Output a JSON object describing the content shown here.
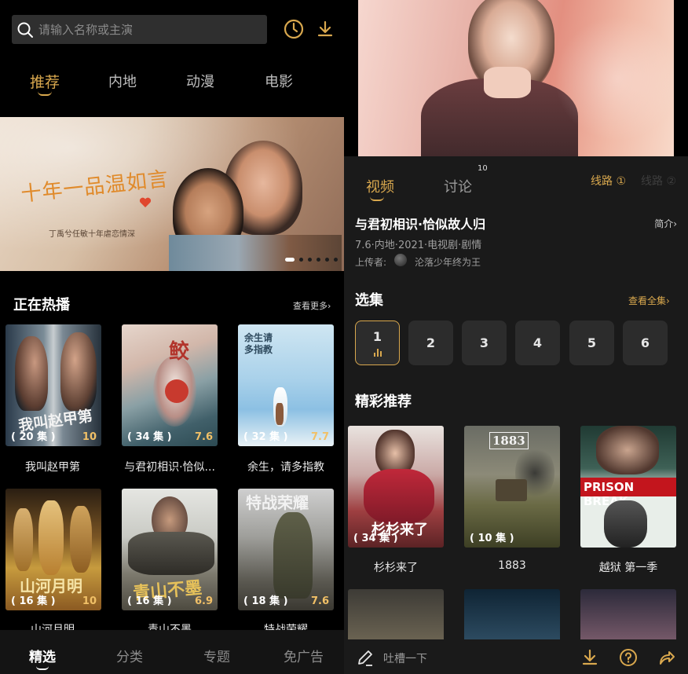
{
  "left": {
    "search": {
      "placeholder": "请输入名称或主演"
    },
    "top_icons": [
      "history-clock-icon",
      "download-icon"
    ],
    "tabs": [
      {
        "label": "推荐",
        "active": true
      },
      {
        "label": "内地",
        "active": false
      },
      {
        "label": "动漫",
        "active": false
      },
      {
        "label": "电影",
        "active": false
      }
    ],
    "banner": {
      "title": "十年一品温如言",
      "subtitle": "丁禹兮任敏十年虐恋情深",
      "slide_count": 6,
      "active_slide": 1
    },
    "hot": {
      "title": "正在热播",
      "more": "查看更多›",
      "items": [
        {
          "title": "我叫赵甲第",
          "episodes": "( 20 集 )",
          "score": "10",
          "poster_text": "我叫赵甲第"
        },
        {
          "title": "与君初相识·恰似...",
          "episodes": "( 34 集 )",
          "score": "7.6",
          "poster_text": "鲛"
        },
        {
          "title": "余生，请多指教",
          "episodes": "( 32 集 )",
          "score": "7.7",
          "poster_text": "余生请多指教"
        },
        {
          "title": "山河月明",
          "episodes": "( 16 集 )",
          "score": "10",
          "poster_text": "山河月明"
        },
        {
          "title": "青山不墨",
          "episodes": "( 16 集 )",
          "score": "6.9",
          "poster_text": "青山不墨"
        },
        {
          "title": "特战荣耀",
          "episodes": "( 18 集 )",
          "score": "7.6",
          "poster_text": "特战荣耀"
        }
      ]
    },
    "bottom_nav": [
      {
        "label": "精选",
        "active": true
      },
      {
        "label": "分类",
        "active": false
      },
      {
        "label": "专题",
        "active": false
      },
      {
        "label": "免广告",
        "active": false
      }
    ]
  },
  "right": {
    "tabs": [
      {
        "label": "视频",
        "active": true
      },
      {
        "label": "讨论",
        "active": false
      }
    ],
    "discuss_count": "10",
    "routes": [
      {
        "label": "线路 ①",
        "active": true
      },
      {
        "label": "线路 ②",
        "active": false
      }
    ],
    "show": {
      "title": "与君初相识·恰似故人归",
      "intro": "简介›",
      "meta": "7.6·内地·2021·电视剧·剧情",
      "uploader_label": "上传者:",
      "uploader_name": "沦落少年终为王"
    },
    "episodes": {
      "title": "选集",
      "view_all": "查看全集›",
      "list": [
        "1",
        "2",
        "3",
        "4",
        "5",
        "6"
      ],
      "current": "1"
    },
    "recommend": {
      "title": "精彩推荐",
      "items": [
        {
          "title": "杉杉来了",
          "episodes": "( 34 集 )",
          "poster_text": "杉杉来了"
        },
        {
          "title": "1883",
          "episodes": "( 10 集 )",
          "poster_text": "1883"
        },
        {
          "title": "越狱 第一季",
          "episodes": "",
          "poster_text": "PRISON BREAK"
        }
      ]
    },
    "bottom": {
      "comment_placeholder": "吐槽一下",
      "icons": [
        "download-icon",
        "help-icon",
        "share-icon"
      ]
    }
  },
  "colors": {
    "accent": "#d9a84e",
    "score": "#f1c067",
    "background_left": "#000000",
    "background_right": "#1a1a1a"
  }
}
